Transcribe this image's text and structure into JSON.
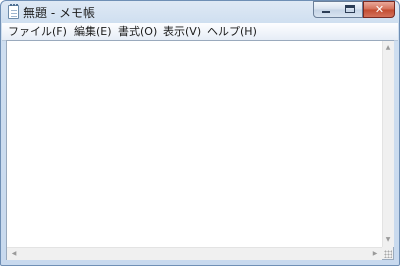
{
  "window": {
    "title": "無題 - メモ帳",
    "close_glyph": "✕"
  },
  "menubar": {
    "items": [
      "ファイル(F)",
      "編集(E)",
      "書式(O)",
      "表示(V)",
      "ヘルプ(H)"
    ]
  },
  "editor": {
    "content": ""
  },
  "icons": {
    "app": "notepad-icon",
    "scroll_up": "▲",
    "scroll_down": "▼",
    "scroll_left": "◀",
    "scroll_right": "▶"
  }
}
